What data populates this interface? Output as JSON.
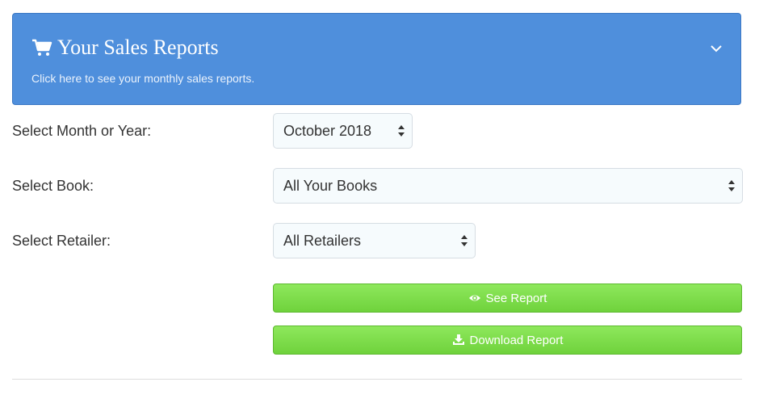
{
  "panel": {
    "title": "Your Sales Reports",
    "subtitle": "Click here to see your monthly sales reports."
  },
  "form": {
    "month_label": "Select Month or Year:",
    "month_value": "October 2018",
    "book_label": "Select Book:",
    "book_value": "All Your Books",
    "retailer_label": "Select Retailer:",
    "retailer_value": "All Retailers"
  },
  "buttons": {
    "see_report": "See Report",
    "download_report": "Download Report"
  },
  "colors": {
    "panel_bg": "#4f8fdc",
    "button_green": "#7ddb4a"
  },
  "icons": {
    "panel": "shopping-cart-icon",
    "toggle": "chevron-down-icon",
    "see": "eye-icon",
    "download": "download-icon"
  }
}
